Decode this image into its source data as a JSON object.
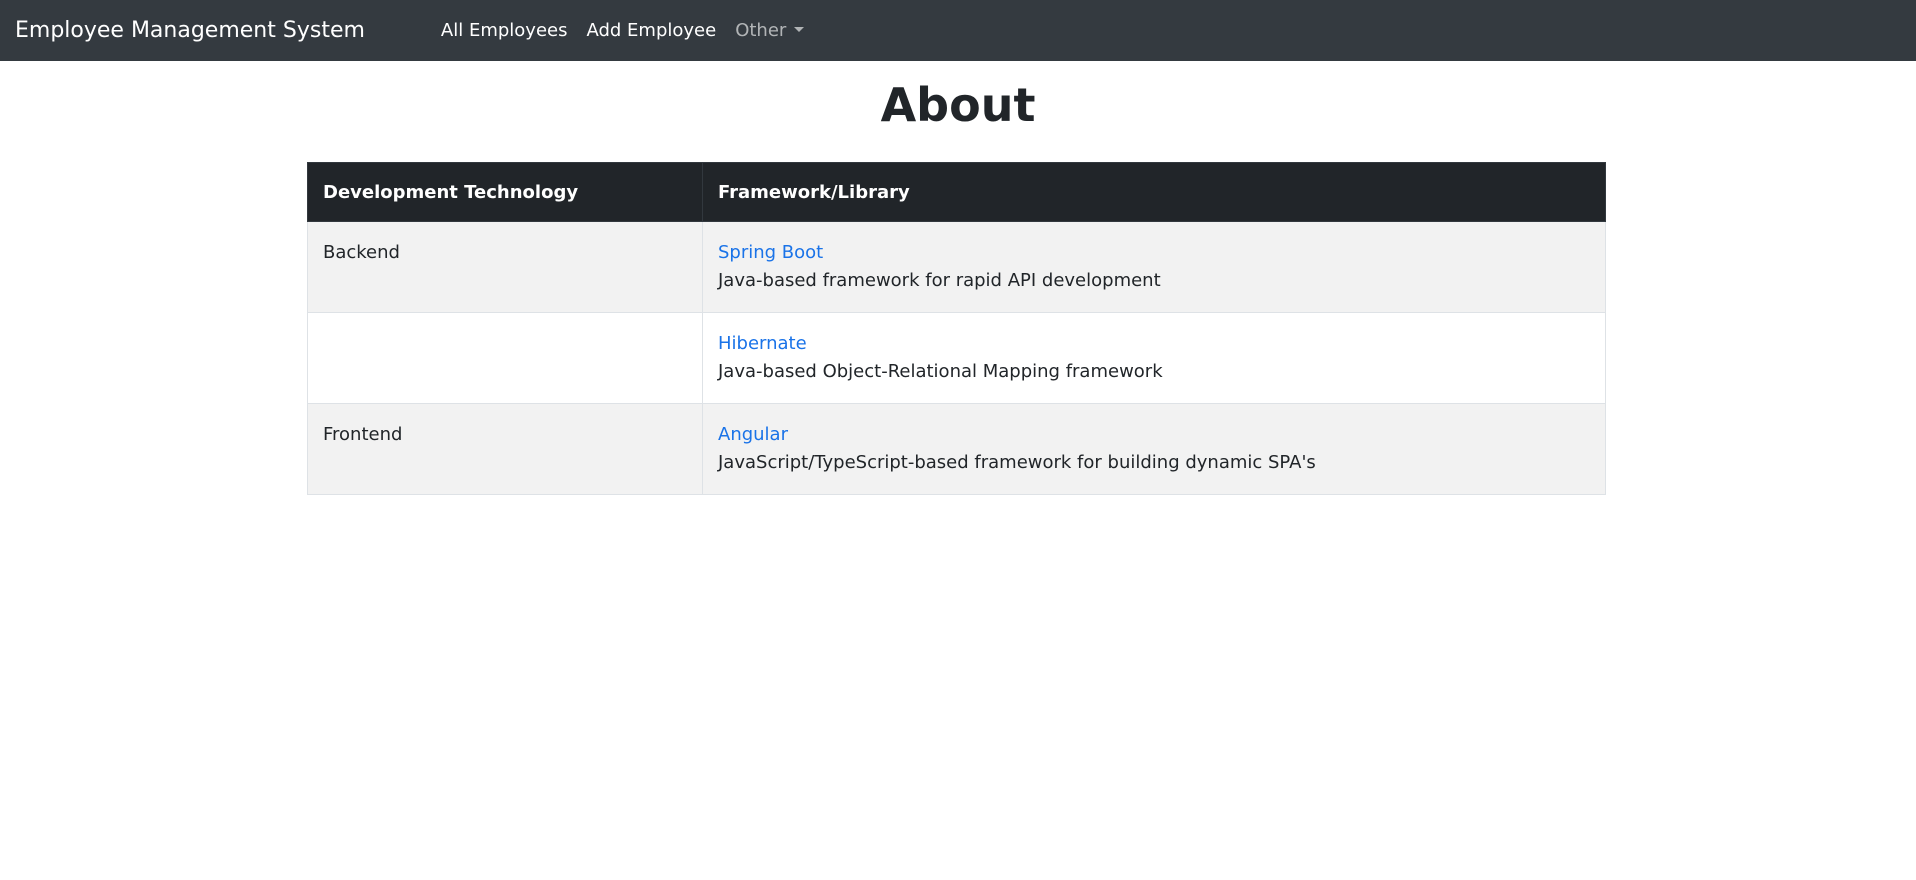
{
  "navbar": {
    "brand": "Employee Management System",
    "links": [
      {
        "label": "All Employees"
      },
      {
        "label": "Add Employee"
      }
    ],
    "dropdown": {
      "label": "Other"
    }
  },
  "page": {
    "title": "About"
  },
  "table": {
    "headers": [
      "Development Technology",
      "Framework/Library"
    ],
    "rows": [
      {
        "technology": "Backend",
        "library": "Spring Boot",
        "description": "Java-based framework for rapid API development"
      },
      {
        "technology": "",
        "library": "Hibernate",
        "description": "Java-based Object-Relational Mapping framework"
      },
      {
        "technology": "Frontend",
        "library": "Angular",
        "description": "JavaScript/TypeScript-based framework for building dynamic SPA's"
      }
    ]
  },
  "colors": {
    "navbar_bg": "#343a40",
    "table_header_bg": "#212529",
    "link": "#1a73e8",
    "stripe": "#f2f2f2"
  }
}
